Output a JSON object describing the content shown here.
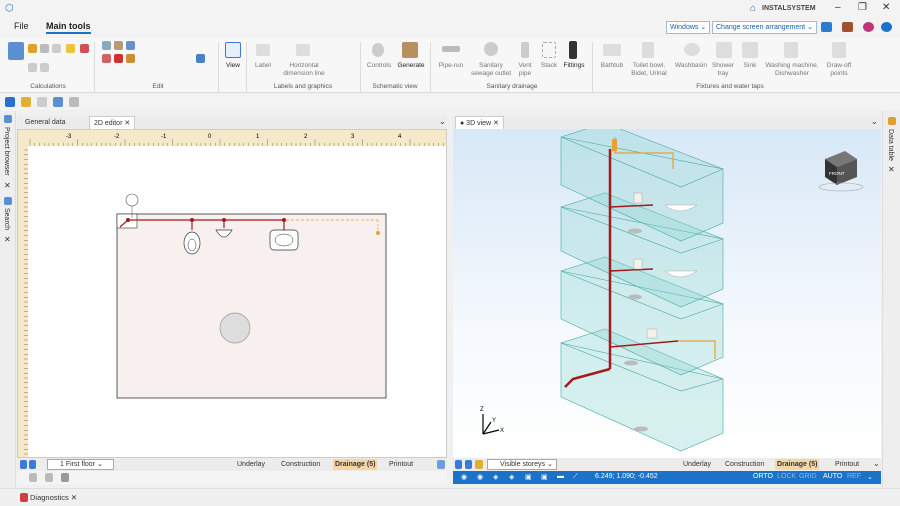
{
  "app": {
    "brand": "INSTALSYSTEM",
    "windows_btn": "Windows",
    "arrangement_btn": "Change screen arrangement"
  },
  "menu": {
    "file": "File",
    "main_tools": "Main tools"
  },
  "ribbon": {
    "groups": {
      "calculations": "Calculations",
      "edit": "Edit",
      "labels": "Labels and graphics",
      "schematic": "Schematic view",
      "sanitary": "Sanitary drainage",
      "fixtures": "Fixtures and water taps"
    },
    "buttons": {
      "view": "View",
      "label": "Label",
      "horiz_dim": "Horizontal\ndimension line",
      "controls": "Controls",
      "generate": "Generate",
      "pipe_run": "Pipe-run",
      "sanitary_outlet": "Sanitary\nsewage outlet",
      "vent_pipe": "Vent\npipe",
      "stack": "Stack",
      "fittings": "Fittings",
      "bathtub": "Bathtub",
      "toilet": "Toilet bowl,\nBidet, Urinal",
      "washbasin": "Washbasin",
      "shower": "Shower\ntray",
      "sink": "Sink",
      "washing": "Washing machine,\nDishwasher",
      "drawoff": "Draw-off\npoints"
    }
  },
  "left_dock": {
    "project_browser": "Project browser",
    "search": "Search"
  },
  "right_dock": {
    "data_table": "Data table"
  },
  "tabs": {
    "general": "General data",
    "editor2d": "2D editor",
    "view3d": "● 3D view"
  },
  "ruler": {
    "ticks": [
      "-3",
      "-2",
      "-1",
      "0",
      "1",
      "2",
      "3",
      "4"
    ]
  },
  "floor_select": "1 First floor",
  "storeys_select": "Visible storeys",
  "layers": {
    "underlay": "Underlay",
    "construction": "Construction",
    "drainage": "Drainage (5)",
    "printout": "Printout"
  },
  "coords": "6.249; 1.090; -0.452",
  "snap": {
    "orto": "ORTO",
    "lock": "LOCK",
    "grid": "GRID",
    "auto": "AUTO",
    "ref": "REF"
  },
  "diagnostics": "Diagnostics",
  "viewcube": "FRONT",
  "axes": {
    "z": "Z",
    "y": "Y",
    "x": "X"
  },
  "colors": {
    "accent": "#1a73c9",
    "drainage": "#a31a1a",
    "vent": "#e8a030",
    "box": "#8fd6d2"
  }
}
